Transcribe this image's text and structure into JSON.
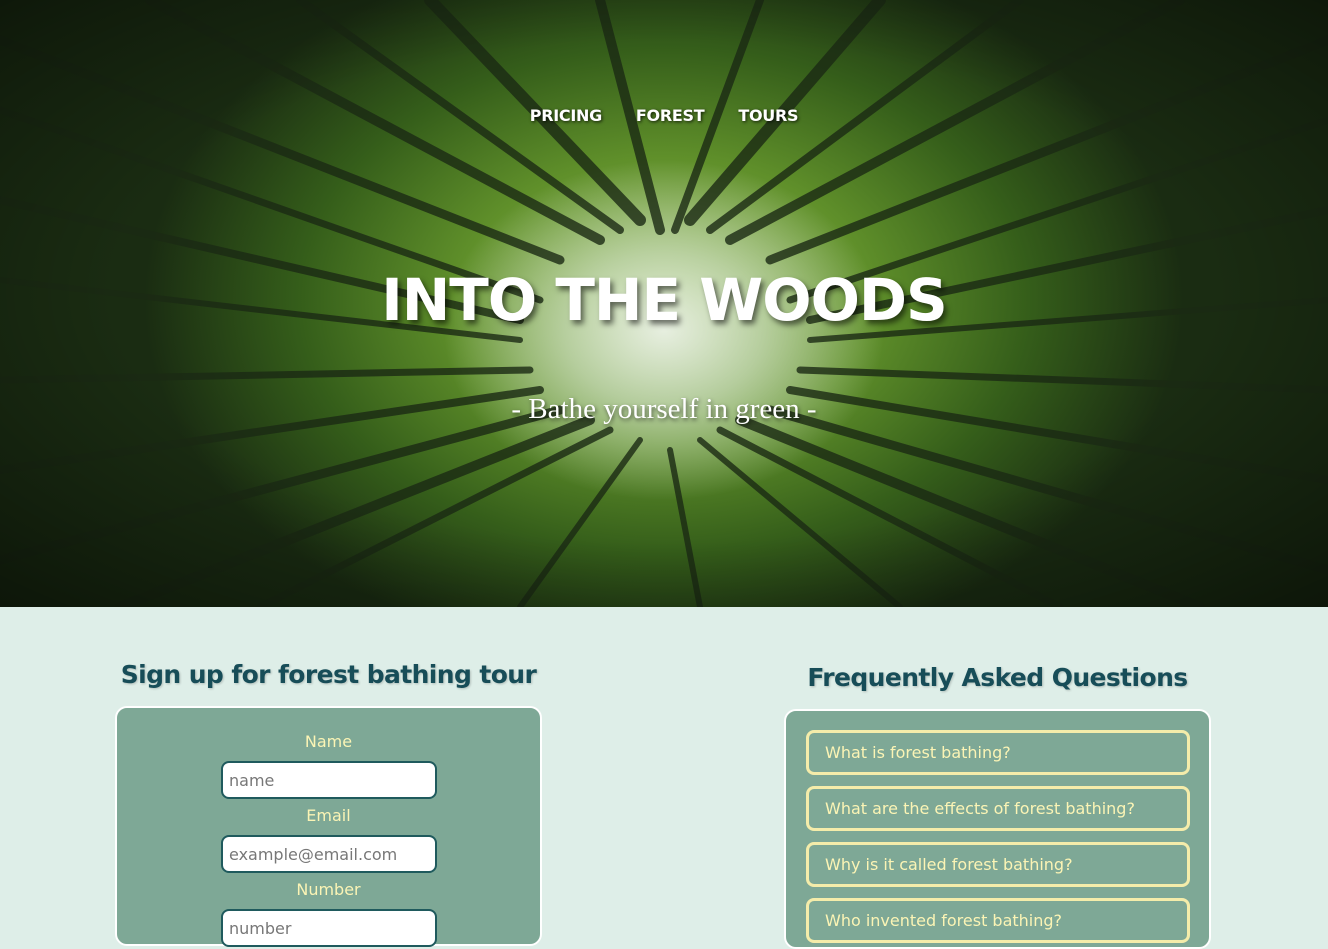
{
  "nav": {
    "items": [
      "PRICING",
      "FOREST",
      "TOURS"
    ]
  },
  "hero": {
    "title": "INTO THE WOODS",
    "subtitle": "- Bathe yourself in green -"
  },
  "signup": {
    "title": "Sign up for forest bathing tour",
    "fields": [
      {
        "label": "Name",
        "placeholder": "name"
      },
      {
        "label": "Email",
        "placeholder": "example@email.com"
      },
      {
        "label": "Number",
        "placeholder": "number"
      }
    ]
  },
  "faq": {
    "title": "Frequently Asked Questions",
    "items": [
      "What is forest bathing?",
      "What are the effects of forest bathing?",
      "Why is it called forest bathing?",
      "Who invented forest bathing?"
    ]
  },
  "colors": {
    "page_bg": "#deeee8",
    "card_bg": "#7ea896",
    "heading": "#174d58",
    "label": "#fbf4b5",
    "faq_border": "#f4ecaa",
    "input_border": "#1f5a5d"
  }
}
